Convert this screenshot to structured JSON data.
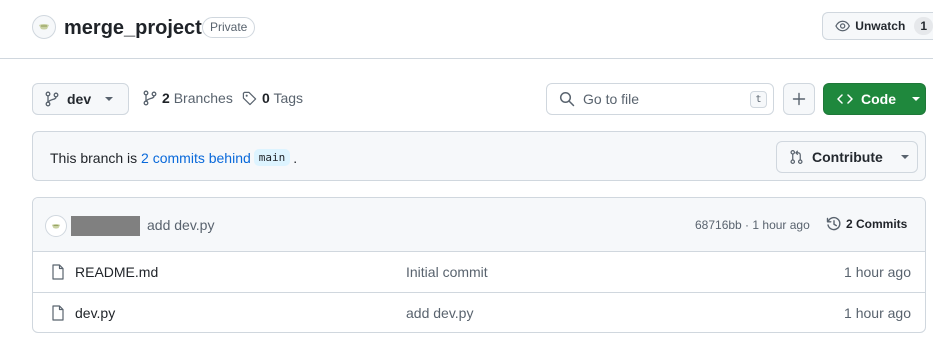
{
  "repo": {
    "name": "merge_project",
    "visibility": "Private",
    "watch_label": "Unwatch",
    "watch_count": "1"
  },
  "toolbar": {
    "branch": "dev",
    "branches_count": "2",
    "branches_label": "Branches",
    "tags_count": "0",
    "tags_label": "Tags",
    "search_placeholder": "Go to file",
    "search_shortcut": "t",
    "code_label": "Code"
  },
  "banner": {
    "prefix": "This branch is ",
    "link": "2 commits behind",
    "base_branch": "main",
    "suffix": ".",
    "contribute_label": "Contribute"
  },
  "latest_commit": {
    "message": "add dev.py",
    "sha": "68716bb",
    "age": "1 hour ago",
    "separator": " · ",
    "commits_label": "2 Commits"
  },
  "files": [
    {
      "name": "README.md",
      "commit_message": "Initial commit",
      "age": "1 hour ago"
    },
    {
      "name": "dev.py",
      "commit_message": "add dev.py",
      "age": "1 hour ago"
    }
  ],
  "colors": {
    "accent": "#0969da",
    "code_button": "#1f883d",
    "border": "#d0d7de"
  }
}
